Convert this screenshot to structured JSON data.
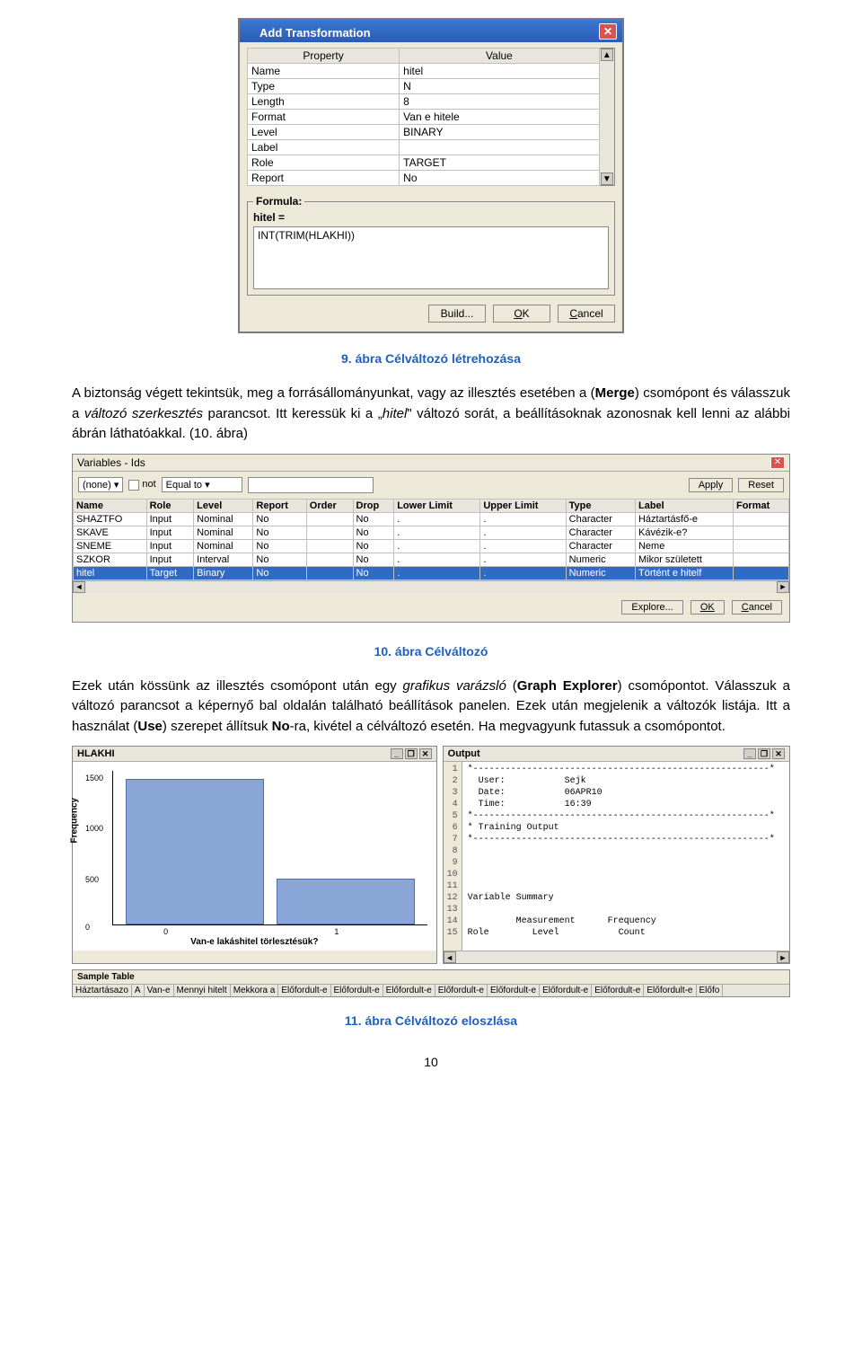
{
  "dialog": {
    "title": "Add Transformation",
    "columns": {
      "property": "Property",
      "value": "Value"
    },
    "rows": [
      {
        "p": "Name",
        "v": "hitel"
      },
      {
        "p": "Type",
        "v": "N"
      },
      {
        "p": "Length",
        "v": "8"
      },
      {
        "p": "Format",
        "v": "Van e hitele"
      },
      {
        "p": "Level",
        "v": "BINARY"
      },
      {
        "p": "Label",
        "v": ""
      },
      {
        "p": "Role",
        "v": "TARGET"
      },
      {
        "p": "Report",
        "v": "No"
      }
    ],
    "formula_legend": "Formula:",
    "formula_label": "hitel =",
    "formula_value": "INT(TRIM(HLAKHI))",
    "btn_build": "Build...",
    "btn_ok": "OK",
    "btn_cancel": "Cancel"
  },
  "captions": {
    "fig9": "9. ábra Célváltozó létrehozása",
    "fig10": "10. ábra Célváltozó",
    "fig11": "11. ábra Célváltozó eloszlása"
  },
  "paras": {
    "p1_a": "A biztonság végett tekintsük, meg a forrásállományunkat, vagy az illesztés esetében a (",
    "p1_merge": "Merge",
    "p1_b": ") csomópont és válasszuk a ",
    "p1_valtozo": "változó szerkesztés",
    "p1_c": " parancsot. Itt keressük ki a „",
    "p1_hitel": "hitel",
    "p1_d": "\" változó sorát, a beállításoknak azonosnak kell lenni az alábbi ábrán láthatóakkal. (10. ábra)",
    "p2_a": "Ezek után kössünk az illesztés csomópont után egy ",
    "p2_graf": "grafikus varázsló",
    "p2_b": " (",
    "p2_ge": "Graph Explorer",
    "p2_c": ") csomópontot. Válasszuk a változó parancsot a képernyő bal oldalán található beállítások panelen. Ezek után megjelenik a változók listája. Itt a használat (",
    "p2_use": "Use",
    "p2_d": ") szerepet állítsuk ",
    "p2_no": "No",
    "p2_e": "-ra, kivétel a célváltozó esetén. Ha megvagyunk futassuk a csomópontot."
  },
  "varWin": {
    "title": "Variables - Ids",
    "filter": {
      "combo1": "(none)",
      "not_label": "not",
      "combo2": "Equal to",
      "apply": "Apply",
      "reset": "Reset"
    },
    "headers": [
      "Name",
      "Role",
      "Level",
      "Report",
      "Order",
      "Drop",
      "Lower Limit",
      "Upper Limit",
      "Type",
      "Label",
      "Format"
    ],
    "rows": [
      [
        "SHAZTFO",
        "Input",
        "Nominal",
        "No",
        "",
        "No",
        ".",
        ".",
        "Character",
        "Háztartásfő-e",
        ""
      ],
      [
        "SKAVE",
        "Input",
        "Nominal",
        "No",
        "",
        "No",
        ".",
        ".",
        "Character",
        "Kávézik-e?",
        ""
      ],
      [
        "SNEME",
        "Input",
        "Nominal",
        "No",
        "",
        "No",
        ".",
        ".",
        "Character",
        "Neme",
        ""
      ],
      [
        "SZKOR",
        "Input",
        "Interval",
        "No",
        "",
        "No",
        ".",
        ".",
        "Numeric",
        "Mikor született",
        ""
      ],
      [
        "hitel",
        "Target",
        "Binary",
        "No",
        "",
        "No",
        ".",
        ".",
        "Numeric",
        "Történt e hitelf",
        ""
      ]
    ],
    "explore": "Explore...",
    "ok": "OK",
    "cancel": "Cancel"
  },
  "chartPanel": {
    "title": "HLAKHI",
    "ylabel": "Frequency",
    "xlabel": "Van-e lakáshitel törlesztésük?",
    "yticks": [
      "1500",
      "1000",
      "500",
      "0"
    ],
    "xticks": [
      "0",
      "1"
    ]
  },
  "outputPanel": {
    "title": "Output",
    "lines": [
      "*-------------------------------------------------------*",
      "  User:           Sejk",
      "  Date:           06APR10",
      "  Time:           16:39",
      "*-------------------------------------------------------*",
      "* Training Output",
      "*-------------------------------------------------------*",
      "",
      "",
      "",
      "",
      "Variable Summary",
      "",
      "         Measurement      Frequency",
      "Role        Level           Count"
    ]
  },
  "chart_data": {
    "type": "bar",
    "categories": [
      "0",
      "1"
    ],
    "values": [
      1600,
      500
    ],
    "xlabel": "Van-e lakáshitel törlesztésük?",
    "ylabel": "Frequency",
    "ylim": [
      0,
      1600
    ]
  },
  "sampleBar": {
    "title": "Sample Table",
    "cols": [
      "Háztartásazo",
      "A",
      "Van-e",
      "Mennyi hitelt",
      "Mekkora a",
      "Előfordult-e",
      "Előfordult-e",
      "Előfordult-e",
      "Előfordult-e",
      "Előfordult-e",
      "Előfordult-e",
      "Előfordult-e",
      "Előfordult-e",
      "Előfo"
    ]
  },
  "pageNum": "10"
}
